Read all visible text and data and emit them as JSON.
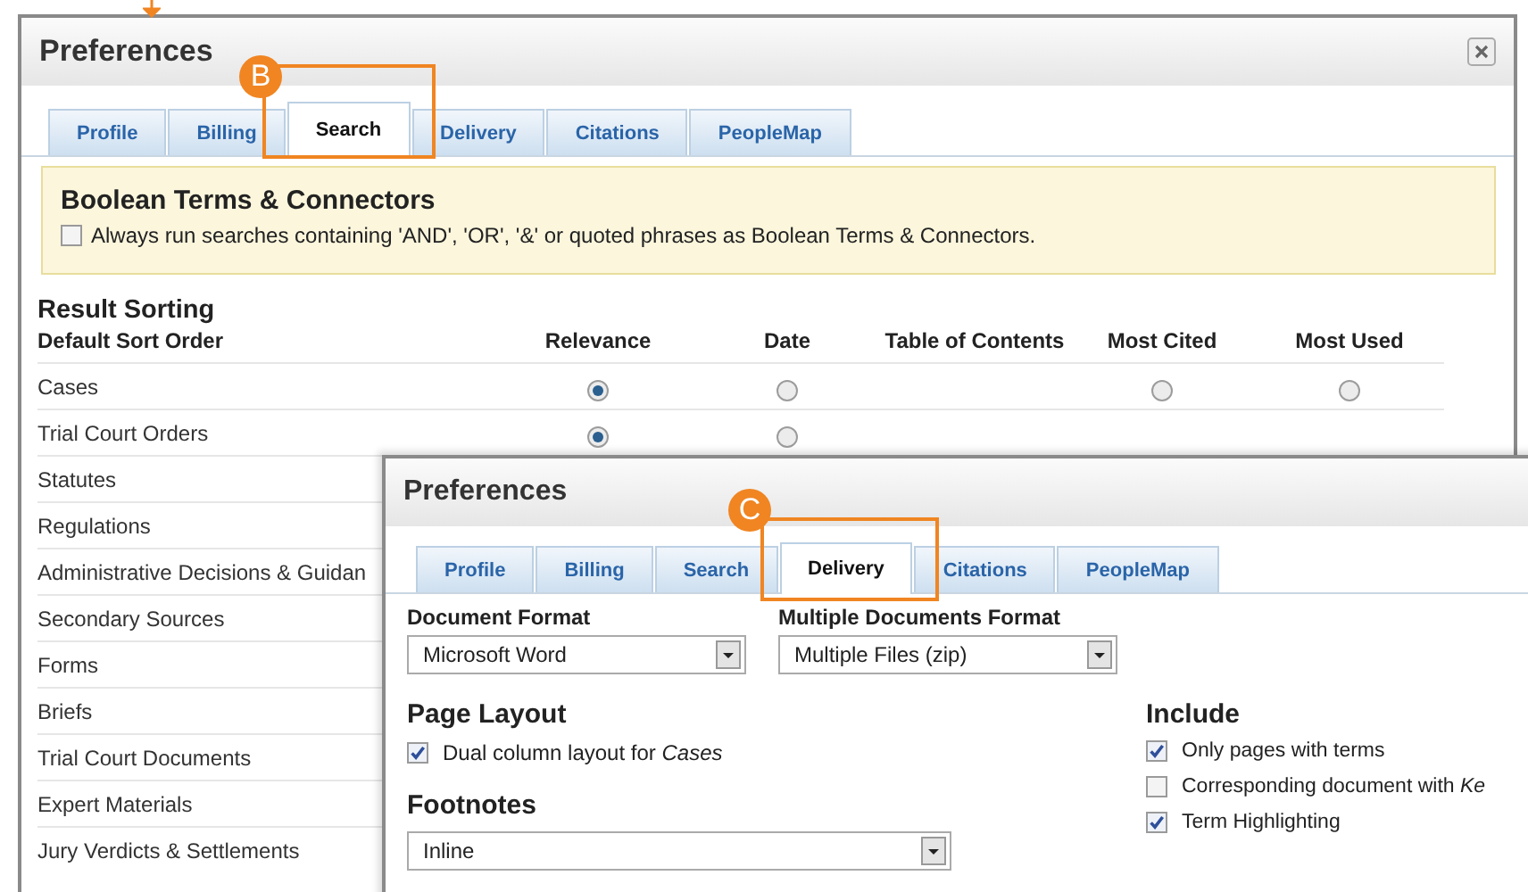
{
  "callouts": [
    {
      "letter": "B"
    },
    {
      "letter": "C"
    }
  ],
  "back_window": {
    "title": "Preferences",
    "tabs": [
      {
        "label": "Profile",
        "selected": false
      },
      {
        "label": "Billing",
        "selected": false
      },
      {
        "label": "Search",
        "selected": true
      },
      {
        "label": "Delivery",
        "selected": false
      },
      {
        "label": "Citations",
        "selected": false
      },
      {
        "label": "PeopleMap",
        "selected": false
      }
    ],
    "boolean_section": {
      "title": "Boolean Terms & Connectors",
      "checkbox": {
        "label": "Always run searches containing 'AND', 'OR', '&' or quoted phrases as Boolean Terms & Connectors.",
        "checked": false
      }
    },
    "result_sorting": {
      "title": "Result Sorting",
      "columns": [
        "Default Sort Order",
        "Relevance",
        "Date",
        "Table of Contents",
        "Most Cited",
        "Most Used"
      ],
      "rows": [
        {
          "label": "Cases",
          "options": [
            {
              "kind": "radio",
              "selected": true
            },
            {
              "kind": "radio",
              "selected": false
            },
            {
              "kind": "empty"
            },
            {
              "kind": "radio",
              "selected": false
            },
            {
              "kind": "radio",
              "selected": false
            }
          ]
        },
        {
          "label": "Trial Court Orders",
          "options": [
            {
              "kind": "radio",
              "selected": true
            },
            {
              "kind": "radio",
              "selected": false
            }
          ]
        },
        {
          "label": "Statutes",
          "options": []
        },
        {
          "label": "Regulations",
          "options": []
        },
        {
          "label": "Administrative Decisions & Guidan",
          "options": []
        },
        {
          "label": "Secondary Sources",
          "options": []
        },
        {
          "label": "Forms",
          "options": []
        },
        {
          "label": "Briefs",
          "options": []
        },
        {
          "label": "Trial Court Documents",
          "options": []
        },
        {
          "label": "Expert Materials",
          "options": []
        },
        {
          "label": "Jury Verdicts & Settlements",
          "options": []
        }
      ]
    }
  },
  "front_window": {
    "title": "Preferences",
    "tabs": [
      {
        "label": "Profile",
        "selected": false
      },
      {
        "label": "Billing",
        "selected": false
      },
      {
        "label": "Search",
        "selected": false
      },
      {
        "label": "Delivery",
        "selected": true
      },
      {
        "label": "Citations",
        "selected": false
      },
      {
        "label": "PeopleMap",
        "selected": false
      }
    ],
    "document_format": {
      "label": "Document Format",
      "value": "Microsoft Word"
    },
    "multiple_documents_format": {
      "label": "Multiple Documents Format",
      "value": "Multiple Files (zip)"
    },
    "page_layout": {
      "title": "Page Layout",
      "options": [
        {
          "label": "Dual column layout for *Cases*",
          "checked": true
        }
      ]
    },
    "footnotes": {
      "title": "Footnotes",
      "value": "Inline"
    },
    "include": {
      "title": "Include",
      "options": [
        {
          "label": "Only pages with terms",
          "checked": true
        },
        {
          "label": "Corresponding document with *Ke*",
          "checked": false
        },
        {
          "label": "Term Highlighting",
          "checked": true
        }
      ]
    }
  }
}
